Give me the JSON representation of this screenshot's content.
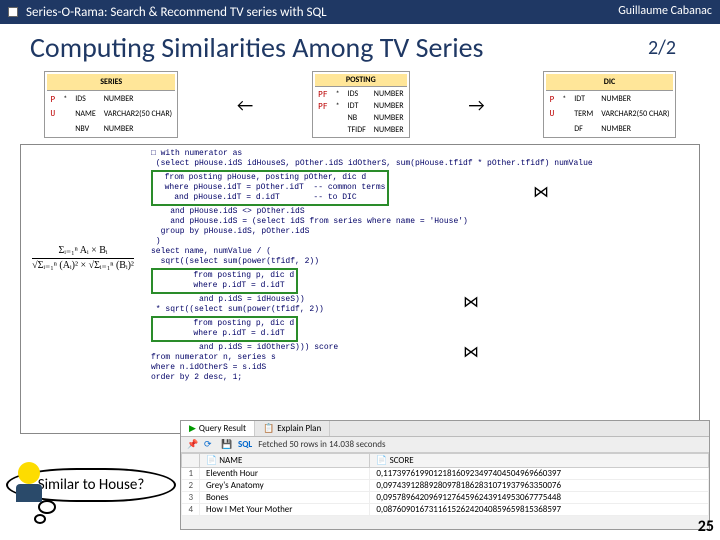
{
  "header": {
    "breadcrumb": "Series-O-Rama: Search & Recommend TV series with SQL",
    "author": "Guillaume Cabanac"
  },
  "title": "Computing Similarities Among TV Series",
  "page_indicator": "2/2",
  "slide_number": "25",
  "schema": {
    "series": {
      "name": "SERIES",
      "rows": [
        [
          "P",
          "*",
          "IDS",
          "NUMBER"
        ],
        [
          "U",
          "",
          "NAME",
          "VARCHAR2(50 CHAR)"
        ],
        [
          "",
          "",
          "NBV",
          "NUMBER"
        ]
      ]
    },
    "posting": {
      "name": "POSTING",
      "rows": [
        [
          "PF",
          "*",
          "IDS",
          "NUMBER"
        ],
        [
          "PF",
          "*",
          "IDT",
          "NUMBER"
        ],
        [
          "",
          "",
          "NB",
          "NUMBER"
        ],
        [
          "",
          "",
          "TFIDF",
          "NUMBER"
        ]
      ]
    },
    "dic": {
      "name": "DIC",
      "rows": [
        [
          "P",
          "*",
          "IDT",
          "NUMBER"
        ],
        [
          "U",
          "",
          "TERM",
          "VARCHAR2(50 CHAR)"
        ],
        [
          "",
          "",
          "DF",
          "NUMBER"
        ]
      ]
    }
  },
  "formula": {
    "num": "Σᵢ₌₁ⁿ Aᵢ × Bᵢ",
    "den_left": "√Σᵢ₌₁ⁿ (Aᵢ)²",
    "den_right": "√Σᵢ₌₁ⁿ (Bᵢ)²"
  },
  "sql": {
    "l01": "□ with numerator as",
    "l02": " (select pHouse.idS idHouseS, pOther.idS idOtherS, sum(pHouse.tfidf * pOther.tfidf) numValue",
    "l03": "  from posting pHouse, posting pOther, dic d",
    "l04": "  where pHouse.idT = pOther.idT  -- common terms",
    "l05": "    and pHouse.idT = d.idT       -- to DIC",
    "l06": "    and pHouse.idS <> pOther.idS",
    "l07": "    and pHouse.idS = (select idS from series where name = 'House')",
    "l08": "  group by pHouse.idS, pOther.idS",
    "l09": " )",
    "l10": "select name, numValue / (",
    "l11": "  sqrt((select sum(power(tfidf, 2))",
    "l12": "        from posting p, dic d",
    "l13": "        where p.idT = d.idT",
    "l14": "          and p.idS = idHouseS))",
    "l15": " * sqrt((select sum(power(tfidf, 2))",
    "l16": "        from posting p, dic d",
    "l17": "        where p.idT = d.idT",
    "l18": "          and p.idS = idOtherS))) score",
    "l19": "from numerator n, series s",
    "l20": "where n.idOtherS = s.idS",
    "l21": "order by 2 desc, 1;"
  },
  "bubble_text": "Similar to House?",
  "result": {
    "tab_query": "Query Result",
    "tab_explain": "Explain Plan",
    "status": "Fetched 50 rows in 14.038 seconds",
    "sql_label": "SQL",
    "col_name": "NAME",
    "col_score": "SCORE",
    "rows": [
      {
        "n": "1",
        "name": "Eleventh Hour",
        "score": "0,117397619901218160923497404504969660397"
      },
      {
        "n": "2",
        "name": "Grey's Anatomy",
        "score": "0,097439128892809781862831071937963350076"
      },
      {
        "n": "3",
        "name": "Bones",
        "score": "0,095789642096912764596243914953067775448"
      },
      {
        "n": "4",
        "name": "How I Met Your Mother",
        "score": "0,087609016731161526242040859659815368597"
      }
    ]
  }
}
